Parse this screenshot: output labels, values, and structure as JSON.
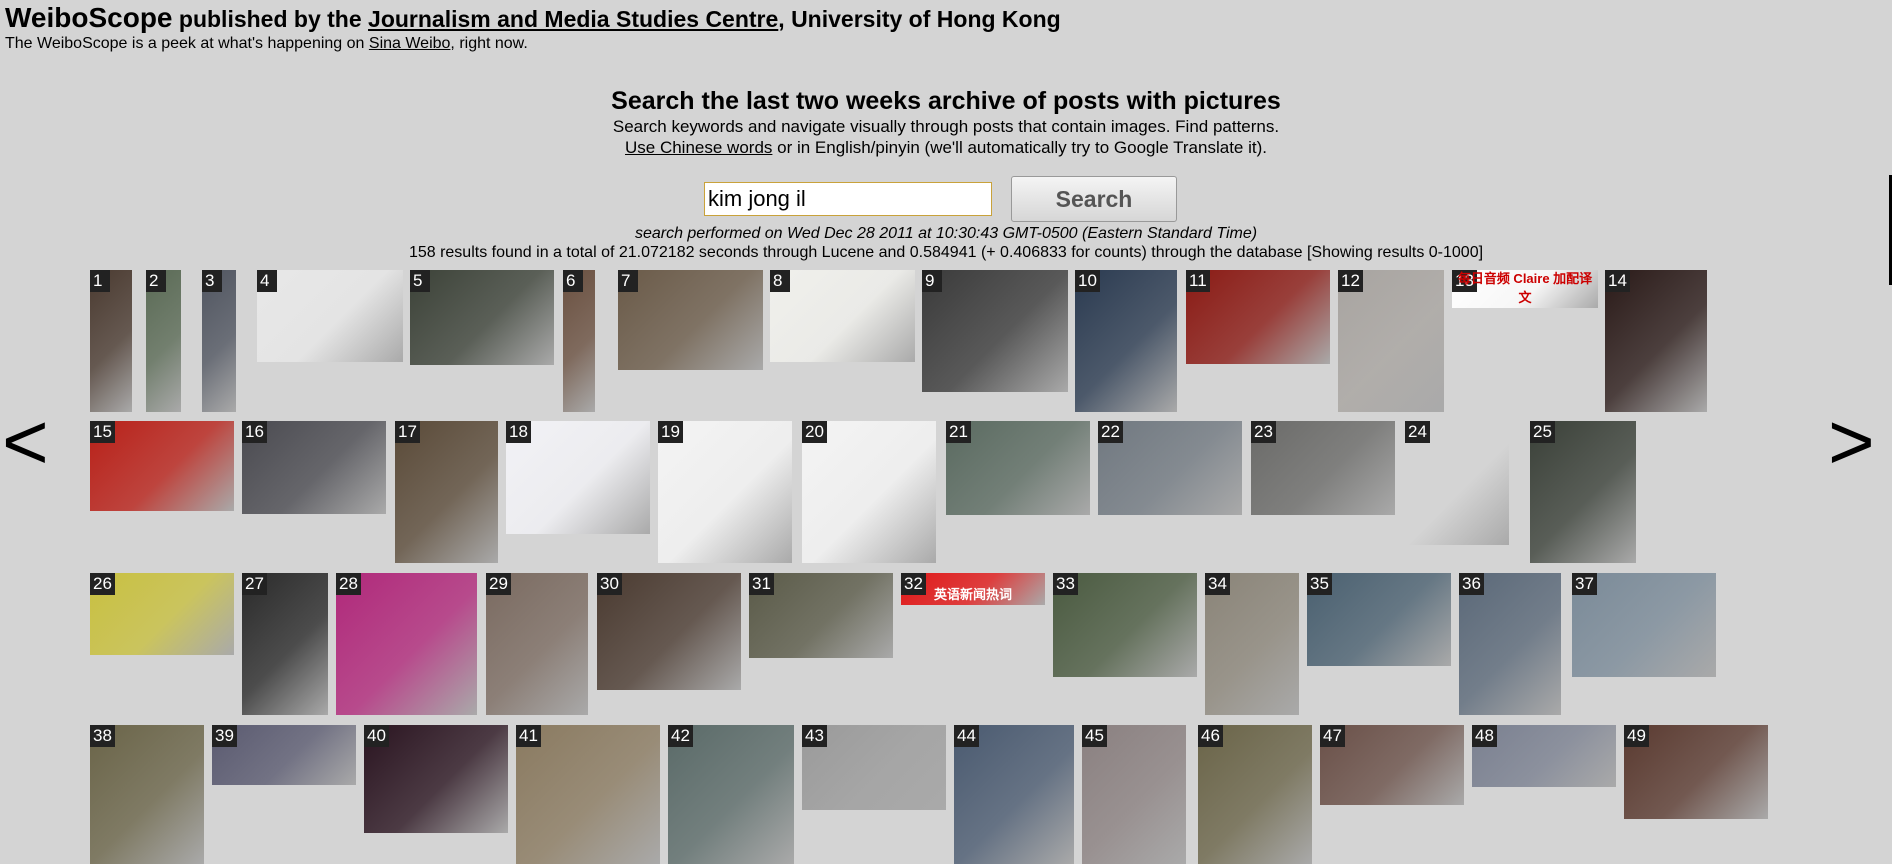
{
  "header": {
    "brand": "WeiboScope",
    "published_by": " published by the ",
    "centre_link": "Journalism and Media Studies Centre",
    "university": ", University of Hong Kong",
    "tagline_pre": "The WeiboScope is a peek at what's happening on ",
    "tagline_link": "Sina Weibo",
    "tagline_post": ", right now."
  },
  "intro": {
    "title": "Search the last two weeks archive of posts with pictures",
    "line1": "Search keywords and navigate visually through posts that contain images. Find patterns.",
    "chinese_link": "Use Chinese words",
    "line2_post": " or in English/pinyin (we'll automatically try to Google Translate it)."
  },
  "search": {
    "query": "kim jong il",
    "button_label": "Search",
    "performed": "search performed on Wed Dec 28 2011 at 10:30:43 GMT-0500 (Eastern Standard Time)",
    "results": "158 results found in a total of 21.072182 seconds through Lucene and 0.584941 (+ 0.406833 for counts) through the database [Showing results 0-1000]"
  },
  "nav": {
    "prev": "<",
    "next": ">"
  },
  "thumbnails": [
    {
      "n": "1",
      "bg": "#4a3a30"
    },
    {
      "n": "2",
      "bg": "#5a6a55"
    },
    {
      "n": "3",
      "bg": "#505560"
    },
    {
      "n": "4",
      "bg": "#e8e8e8"
    },
    {
      "n": "5",
      "bg": "#3c4238"
    },
    {
      "n": "6",
      "bg": "#6a5040"
    },
    {
      "n": "7",
      "bg": "#6a5a48"
    },
    {
      "n": "8",
      "bg": "#f0f0ec"
    },
    {
      "n": "9",
      "bg": "#3a3a3a"
    },
    {
      "n": "10",
      "bg": "#2a3a50"
    },
    {
      "n": "11",
      "bg": "#8a1a14"
    },
    {
      "n": "12",
      "bg": "#a8a4a0"
    },
    {
      "n": "13",
      "bg": "#ffffff",
      "caption": "每日音频  Claire 加配译文"
    },
    {
      "n": "14",
      "bg": "#2a1a18"
    },
    {
      "n": "15",
      "bg": "#b82018"
    },
    {
      "n": "16",
      "bg": "#4a4a50"
    },
    {
      "n": "17",
      "bg": "#5a4a38"
    },
    {
      "n": "18",
      "bg": "#f2f2f6"
    },
    {
      "n": "19",
      "bg": "#f4f4f4"
    },
    {
      "n": "20",
      "bg": "#f4f4f4"
    },
    {
      "n": "21",
      "bg": "#5a6a60"
    },
    {
      "n": "22",
      "bg": "#707880"
    },
    {
      "n": "23",
      "bg": "#6a6a68"
    },
    {
      "n": "24",
      "bg": "#d4d4d4"
    },
    {
      "n": "25",
      "bg": "#3a4038"
    },
    {
      "n": "26",
      "bg": "#c8c040"
    },
    {
      "n": "27",
      "bg": "#2a2a2a"
    },
    {
      "n": "28",
      "bg": "#b0287a"
    },
    {
      "n": "29",
      "bg": "#7a6a60"
    },
    {
      "n": "30",
      "bg": "#4a3a30"
    },
    {
      "n": "31",
      "bg": "#5a5a48"
    },
    {
      "n": "32",
      "bg": "#e01818",
      "caption": "英语新闻热词"
    },
    {
      "n": "33",
      "bg": "#4a5a40"
    },
    {
      "n": "34",
      "bg": "#8a8478"
    },
    {
      "n": "35",
      "bg": "#4a6070"
    },
    {
      "n": "36",
      "bg": "#5a6878"
    },
    {
      "n": "37",
      "bg": "#7a8a98"
    },
    {
      "n": "38",
      "bg": "#6a6448"
    },
    {
      "n": "39",
      "bg": "#5a5a70"
    },
    {
      "n": "40",
      "bg": "#2a1420"
    },
    {
      "n": "41",
      "bg": "#8a7a60"
    },
    {
      "n": "42",
      "bg": "#5a6a68"
    },
    {
      "n": "43",
      "bg": "#9a9a9a"
    },
    {
      "n": "44",
      "bg": "#4a5a70"
    },
    {
      "n": "45",
      "bg": "#8a8080"
    },
    {
      "n": "46",
      "bg": "#6a6448"
    },
    {
      "n": "47",
      "bg": "#6a5048"
    },
    {
      "n": "48",
      "bg": "#7a8090"
    },
    {
      "n": "49",
      "bg": "#5a3a30"
    }
  ]
}
